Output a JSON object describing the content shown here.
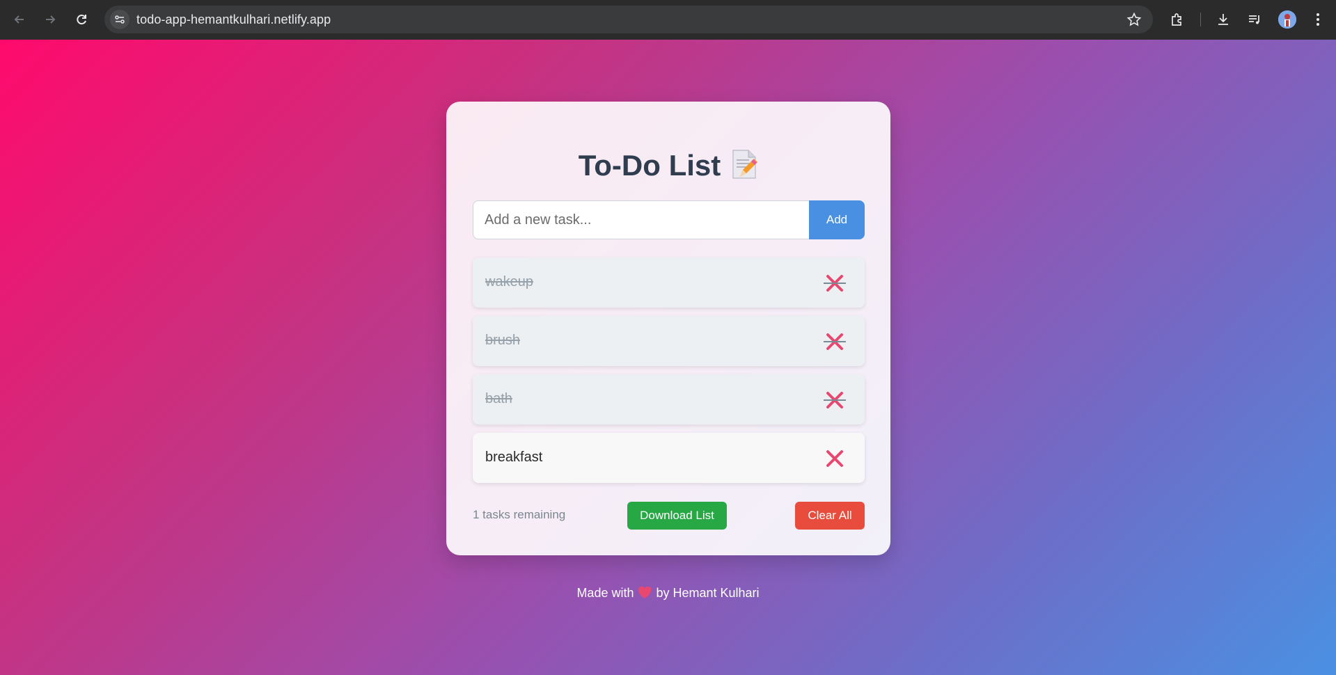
{
  "browser": {
    "url": "todo-app-hemantkulhari.netlify.app",
    "icons": [
      "back-icon",
      "forward-icon",
      "reload-icon",
      "site-info-icon",
      "star-icon",
      "extensions-icon",
      "download-icon",
      "media-icon",
      "profile-avatar",
      "menu-icon"
    ]
  },
  "app": {
    "title": "To-Do List",
    "title_icon": "memo-icon",
    "input_placeholder": "Add a new task...",
    "add_label": "Add",
    "tasks": [
      {
        "text": "wakeup",
        "completed": true
      },
      {
        "text": "brush",
        "completed": true
      },
      {
        "text": "bath",
        "completed": true
      },
      {
        "text": "breakfast",
        "completed": false
      }
    ],
    "remaining_text": "1 tasks remaining",
    "download_label": "Download List",
    "clear_label": "Clear All"
  },
  "footer": {
    "prefix": "Made with",
    "heart_icon": "heart-icon",
    "suffix": "by Hemant Kulhari"
  },
  "colors": {
    "add_button": "#4a90e2",
    "download_button": "#28a745",
    "clear_button": "#e74c3c",
    "delete_icon": "#e8476f",
    "title": "#2f3d4f"
  }
}
